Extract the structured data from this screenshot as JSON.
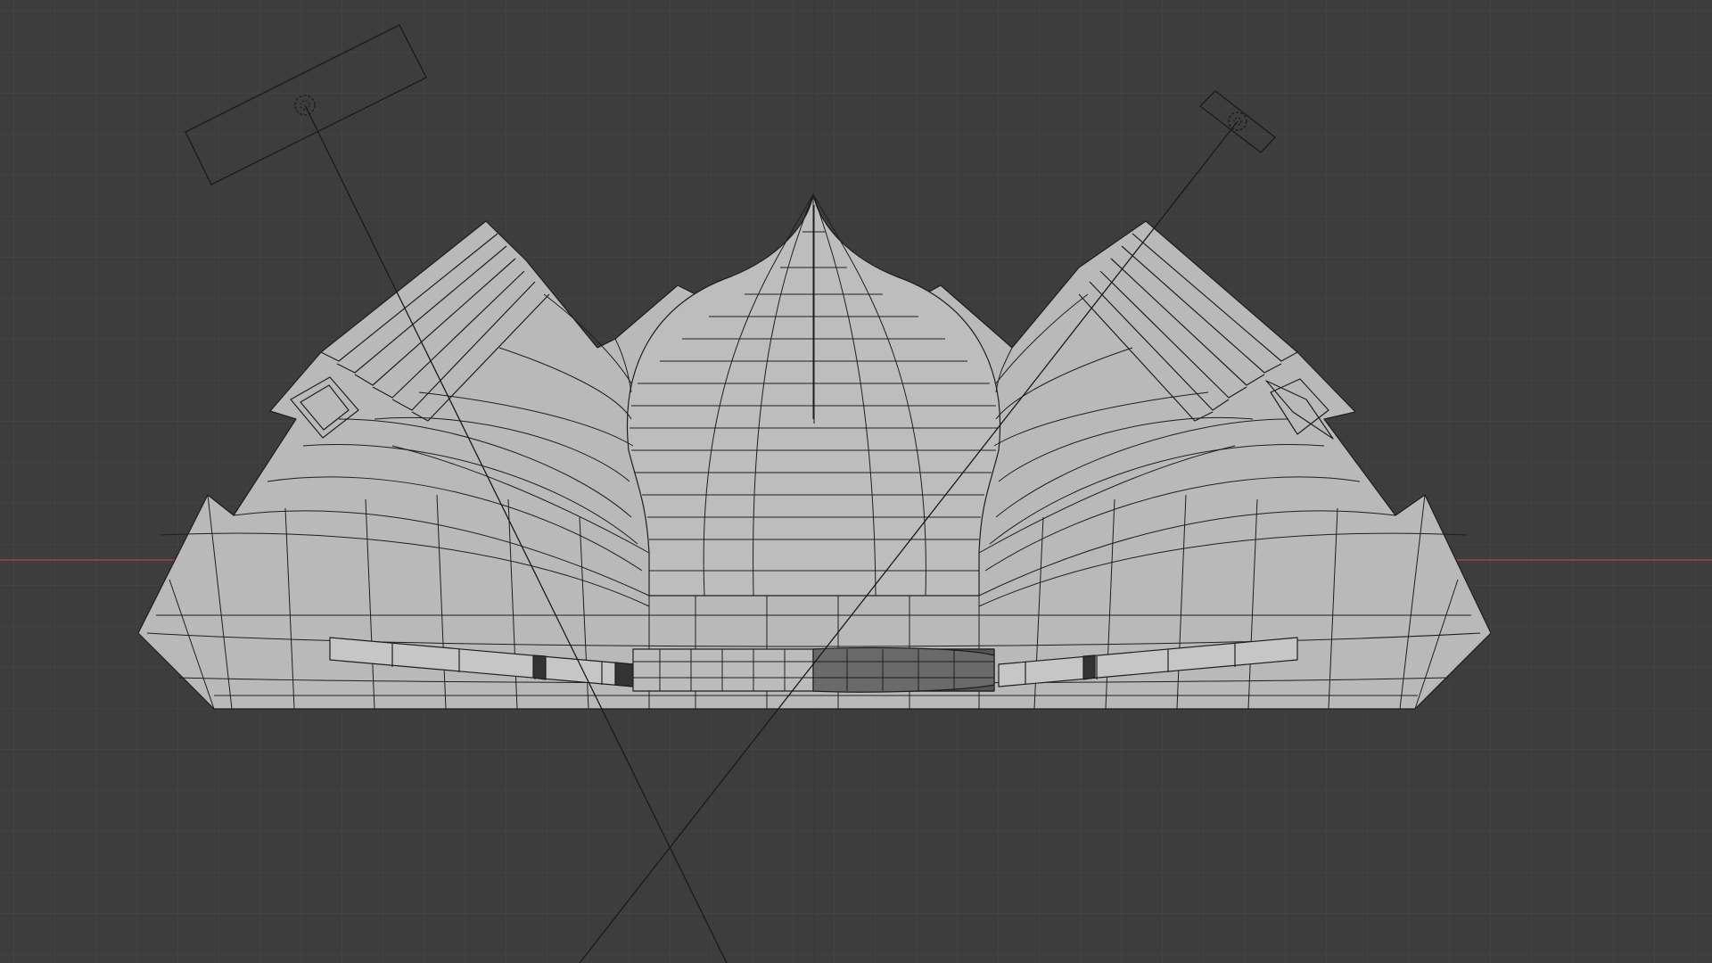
{
  "viewport": {
    "view": "front-orthographic",
    "shading": "solid-wireframe",
    "background_color": "#3d3d3d",
    "grid_color": "#474747",
    "grid_major_color": "#4c4c4c",
    "x_axis_color": "#c04b4b",
    "z_axis_color": "#3a5a3a",
    "mesh_fill_color": "#b9b9b9",
    "wire_color": "#1e1e1e"
  },
  "objects": [
    {
      "name": "building-mesh",
      "icon": "mesh-icon"
    },
    {
      "name": "light-left",
      "icon": "area-light-icon"
    },
    {
      "name": "light-right",
      "icon": "area-light-icon"
    }
  ]
}
